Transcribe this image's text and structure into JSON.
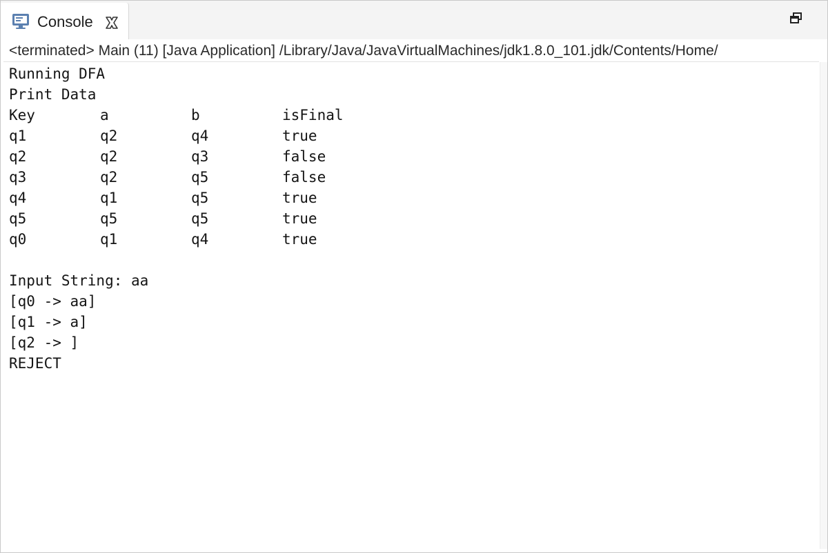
{
  "tab": {
    "label": "Console",
    "icon": "console-monitor-icon",
    "close_icon": "close-icon",
    "accent_color": "#5b80b0"
  },
  "toolbar": {
    "restore_icon": "restore-window-icon"
  },
  "status": {
    "text": "<terminated> Main (11) [Java Application] /Library/Java/JavaVirtualMachines/jdk1.8.0_101.jdk/Contents/Home/"
  },
  "output": {
    "lines_before": [
      "Running DFA",
      "Print Data"
    ],
    "table": {
      "headers": [
        "Key",
        "a",
        "b",
        "isFinal"
      ],
      "rows": [
        [
          "q1",
          "q2",
          "q4",
          "true"
        ],
        [
          "q2",
          "q2",
          "q3",
          "false"
        ],
        [
          "q3",
          "q2",
          "q5",
          "false"
        ],
        [
          "q4",
          "q1",
          "q5",
          "true"
        ],
        [
          "q5",
          "q5",
          "q5",
          "true"
        ],
        [
          "q0",
          "q1",
          "q4",
          "true"
        ]
      ]
    },
    "lines_after": [
      "",
      "Input String: aa",
      "[q0 -> aa]",
      "[q1 -> a]",
      "[q2 -> ]",
      "REJECT"
    ]
  }
}
